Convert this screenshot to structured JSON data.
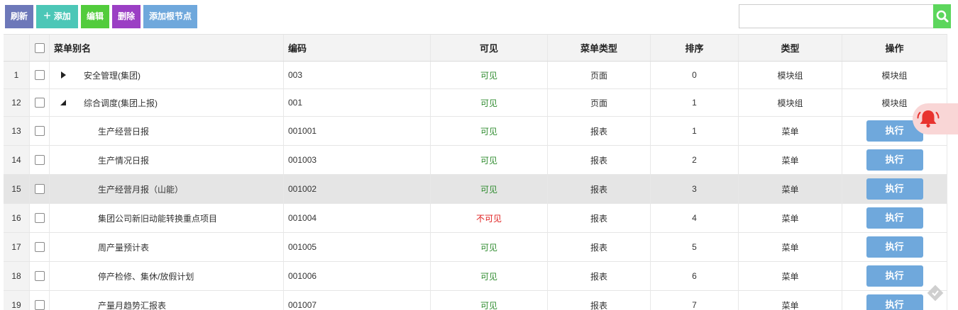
{
  "toolbar": {
    "refresh": {
      "label": "刷新",
      "color": "#6d78b9"
    },
    "add": {
      "label": "添加",
      "color": "#4cc7b7"
    },
    "edit": {
      "label": "编辑",
      "color": "#52cc3c"
    },
    "delete": {
      "label": "删除",
      "color": "#9b3fc4"
    },
    "add_root": {
      "label": "添加根节点",
      "color": "#6fa8dc"
    }
  },
  "search": {
    "value": "",
    "placeholder": "",
    "icon": "search-icon"
  },
  "columns": [
    "菜单别名",
    "编码",
    "可见",
    "菜单类型",
    "排序",
    "类型",
    "操作"
  ],
  "rows": [
    {
      "num": "1",
      "expander": "collapsed",
      "level": 0,
      "name": "安全管理(集团)",
      "code": "003",
      "visible": "可见",
      "visible_state": "yes",
      "menu_type": "页面",
      "order": "0",
      "type": "模块组",
      "action": "模块组",
      "action_kind": "text"
    },
    {
      "num": "12",
      "expander": "expanded",
      "level": 0,
      "name": "综合调度(集团上报)",
      "code": "001",
      "visible": "可见",
      "visible_state": "yes",
      "menu_type": "页面",
      "order": "1",
      "type": "模块组",
      "action": "模块组",
      "action_kind": "text"
    },
    {
      "num": "13",
      "expander": "none",
      "level": 1,
      "name": "生产经营日报",
      "code": "001001",
      "visible": "可见",
      "visible_state": "yes",
      "menu_type": "报表",
      "order": "1",
      "type": "菜单",
      "action": "执行",
      "action_kind": "button"
    },
    {
      "num": "14",
      "expander": "none",
      "level": 1,
      "name": "生产情况日报",
      "code": "001003",
      "visible": "可见",
      "visible_state": "yes",
      "menu_type": "报表",
      "order": "2",
      "type": "菜单",
      "action": "执行",
      "action_kind": "button"
    },
    {
      "num": "15",
      "expander": "none",
      "level": 1,
      "name": "生产经营月报（山能）",
      "code": "001002",
      "visible": "可见",
      "visible_state": "yes",
      "menu_type": "报表",
      "order": "3",
      "type": "菜单",
      "action": "执行",
      "action_kind": "button",
      "highlight": true
    },
    {
      "num": "16",
      "expander": "none",
      "level": 1,
      "name": "集团公司新旧动能转换重点项目",
      "code": "001004",
      "visible": "不可见",
      "visible_state": "no",
      "menu_type": "报表",
      "order": "4",
      "type": "菜单",
      "action": "执行",
      "action_kind": "button"
    },
    {
      "num": "17",
      "expander": "none",
      "level": 1,
      "name": "周产量预计表",
      "code": "001005",
      "visible": "可见",
      "visible_state": "yes",
      "menu_type": "报表",
      "order": "5",
      "type": "菜单",
      "action": "执行",
      "action_kind": "button"
    },
    {
      "num": "18",
      "expander": "none",
      "level": 1,
      "name": "停产检修、集休/放假计划",
      "code": "001006",
      "visible": "可见",
      "visible_state": "yes",
      "menu_type": "报表",
      "order": "6",
      "type": "菜单",
      "action": "执行",
      "action_kind": "button"
    },
    {
      "num": "19",
      "expander": "none",
      "level": 1,
      "name": "产量月趋势汇报表",
      "code": "001007",
      "visible": "可见",
      "visible_state": "yes",
      "menu_type": "报表",
      "order": "7",
      "type": "菜单",
      "action": "执行",
      "action_kind": "button"
    }
  ],
  "colors": {
    "visible_yes": "#2e8b2e",
    "visible_no": "#e02020",
    "execute_button": "#6fa8dc",
    "bell": "#e8332f"
  },
  "floating": {
    "bell_icon": "bell-icon",
    "corner_icon": "diamond-icon"
  }
}
